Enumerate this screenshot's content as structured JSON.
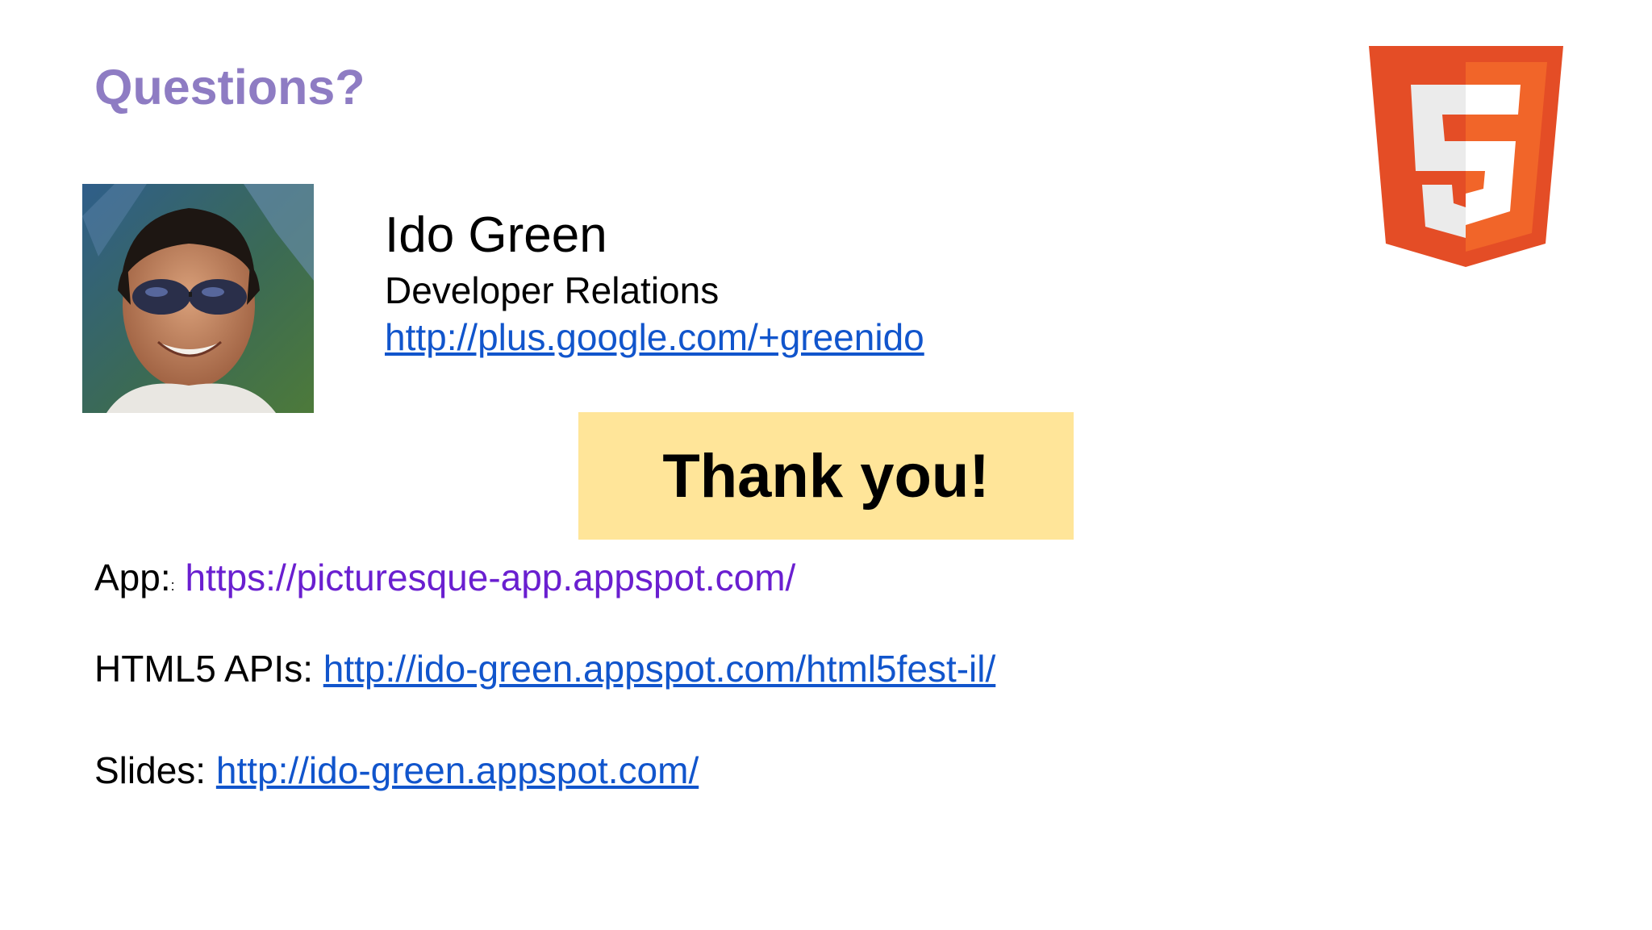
{
  "slide": {
    "title": "Questions?",
    "speaker": {
      "name": "Ido Green",
      "role": "Developer Relations",
      "profile_url": "http://plus.google.com/+greenido"
    },
    "thanks": "Thank you!",
    "links": {
      "app_label": "App:",
      "app_sep": ":",
      "app_url": "https://picturesque-app.appspot.com/",
      "apis_label": "HTML5 APIs: ",
      "apis_url": "http://ido-green.appspot.com/html5fest-il/",
      "slides_label": "Slides: ",
      "slides_url": "http://ido-green.appspot.com/"
    },
    "colors": {
      "title": "#8e7cc3",
      "link": "#1155cc",
      "app_link": "#6a1fd0",
      "thanks_box": "#ffe599",
      "html5_orange": "#e44d26",
      "html5_orange_light": "#f16529"
    },
    "icons": {
      "logo": "html5-logo",
      "photo": "speaker-photo"
    }
  }
}
